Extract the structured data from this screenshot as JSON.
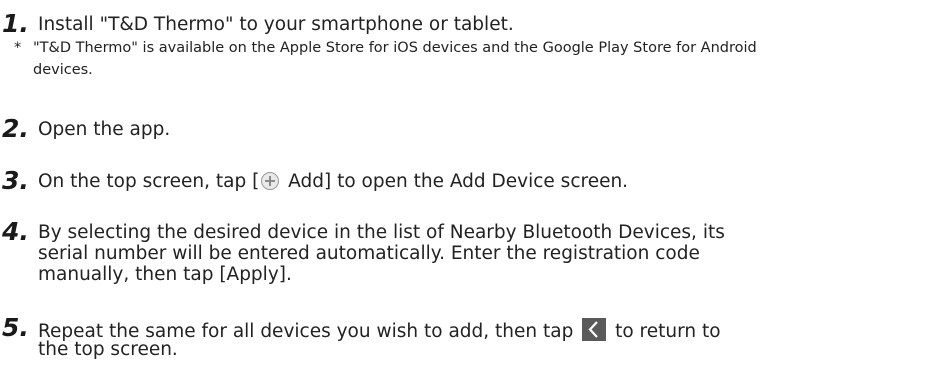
{
  "steps": [
    {
      "number": "1.",
      "text": "Install \"T&D Thermo\" to your smartphone or tablet.",
      "note_star": "*",
      "note": "\"T&D Thermo\" is available on the Apple Store for iOS devices and the Google Play Store for Android devices."
    },
    {
      "number": "2.",
      "text": "Open the app."
    },
    {
      "number": "3.",
      "text_before": "On the top screen, tap [",
      "text_after": " Add] to open the Add Device screen.",
      "icon": "add-circle-icon"
    },
    {
      "number": "4.",
      "line1": "By selecting the desired device in the list of Nearby Bluetooth Devices, its",
      "line2": "serial number will be entered automatically. Enter the registration code",
      "line3": "manually, then tap [Apply]."
    },
    {
      "number": "5.",
      "text_before": "Repeat the same for all devices you wish to add, then tap ",
      "text_after": " to return to",
      "line2": "the top screen.",
      "icon": "back-chevron-icon"
    }
  ]
}
